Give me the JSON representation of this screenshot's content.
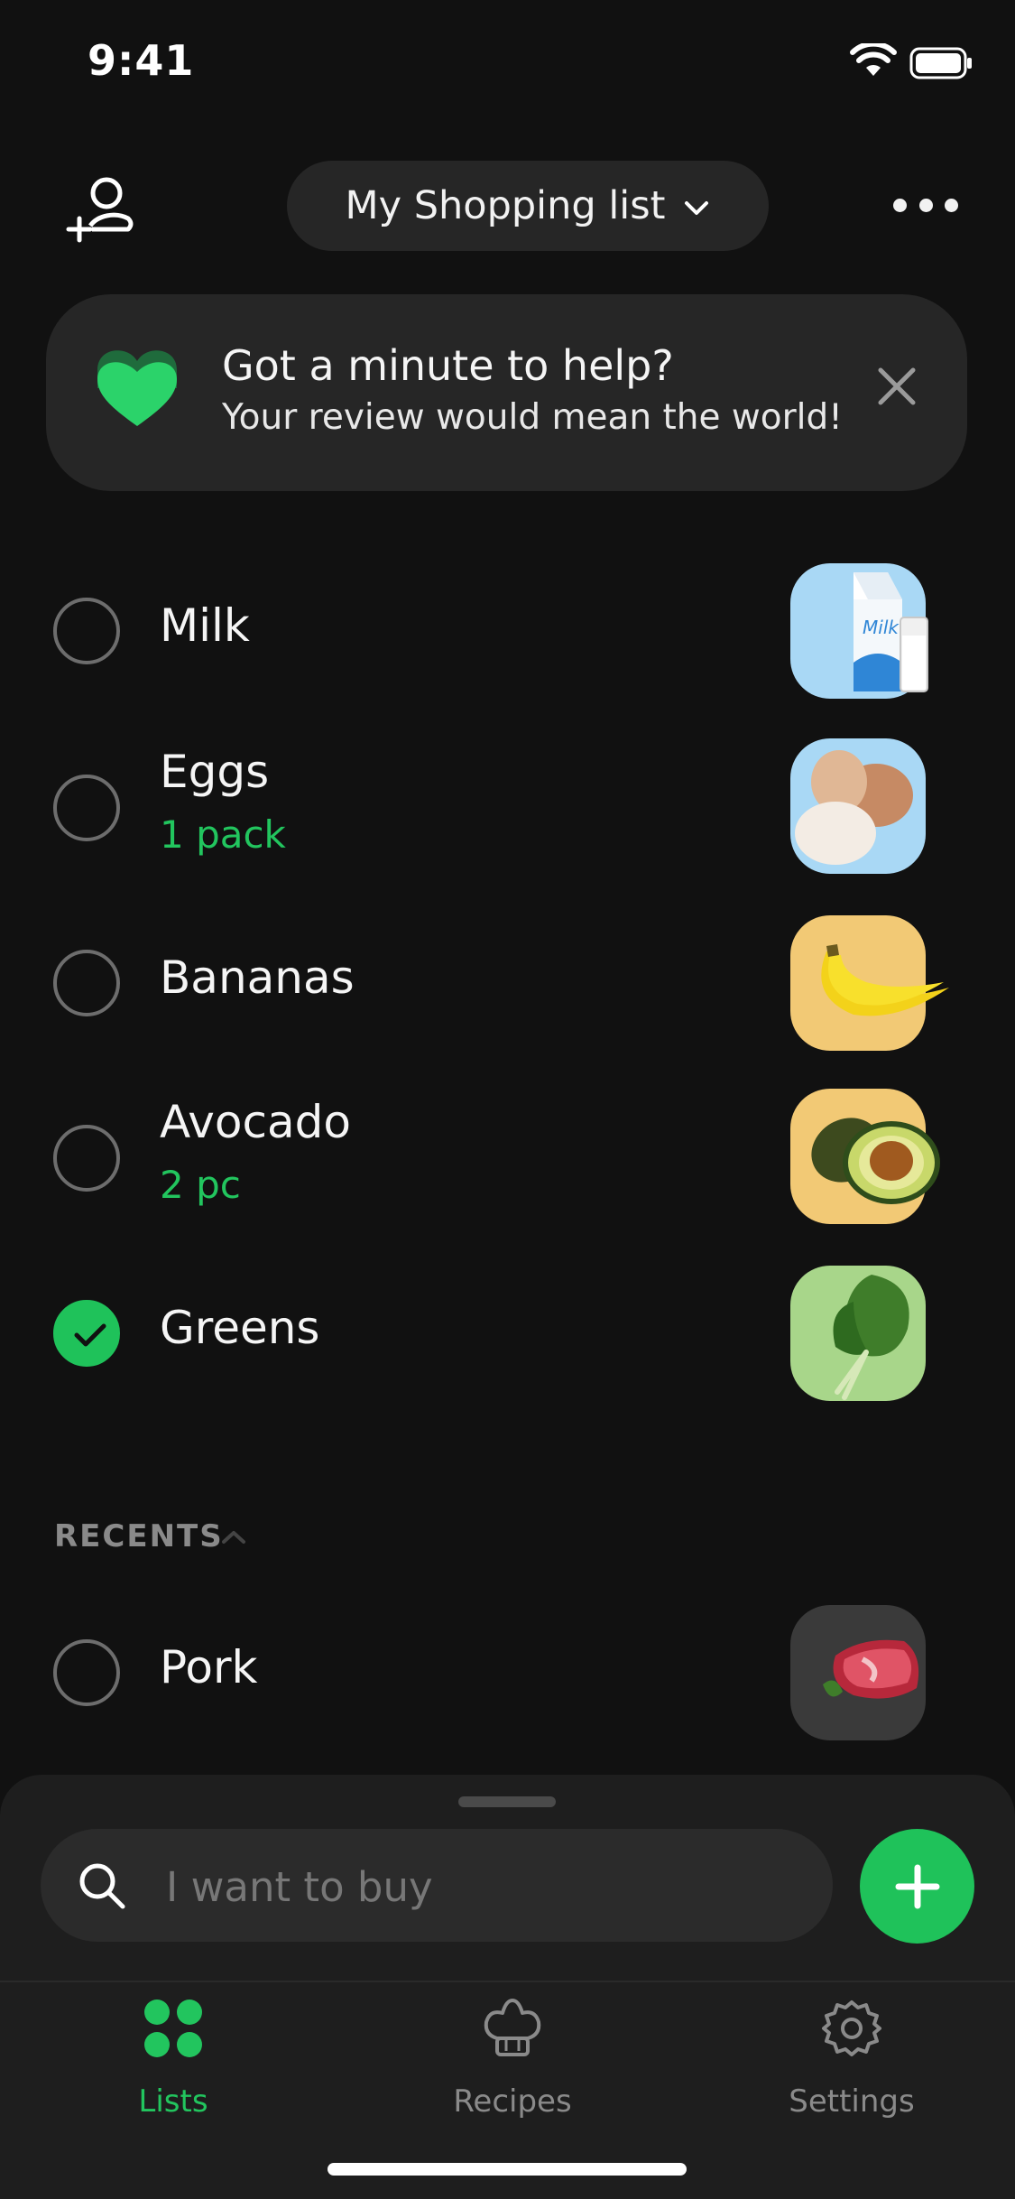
{
  "status_bar": {
    "time": "9:41"
  },
  "header": {
    "list_title": "My Shopping list"
  },
  "banner": {
    "title": "Got a minute to help?",
    "subtitle": "Your review would mean the world!"
  },
  "items": [
    {
      "name": "Milk",
      "qty": "",
      "checked": false,
      "image": "milk-carton-icon"
    },
    {
      "name": "Eggs",
      "qty": "1 pack",
      "checked": false,
      "image": "eggs-icon"
    },
    {
      "name": "Bananas",
      "qty": "",
      "checked": false,
      "image": "bananas-icon"
    },
    {
      "name": "Avocado",
      "qty": "2 pc",
      "checked": false,
      "image": "avocado-icon"
    },
    {
      "name": "Greens",
      "qty": "",
      "checked": true,
      "image": "greens-icon"
    }
  ],
  "recents": {
    "header": "RECENTS",
    "items": [
      {
        "name": "Pork",
        "qty": "",
        "checked": false,
        "image": "pork-icon"
      }
    ]
  },
  "search": {
    "placeholder": "I want to buy"
  },
  "tabs": [
    {
      "label": "Lists",
      "icon": "lists-icon",
      "active": true
    },
    {
      "label": "Recipes",
      "icon": "chef-hat-icon",
      "active": false
    },
    {
      "label": "Settings",
      "icon": "gear-icon",
      "active": false
    }
  ],
  "colors": {
    "accent": "#22c55e",
    "background": "#111111",
    "surface": "#262626"
  }
}
